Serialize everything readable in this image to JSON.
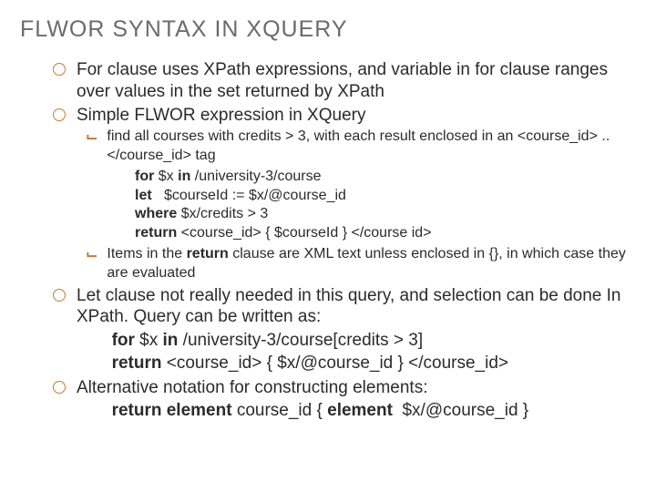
{
  "title": "FLWOR SYNTAX IN XQUERY",
  "b1": "For clause uses XPath expressions, and variable in for clause ranges over values in the set returned by XPath",
  "b2": "Simple FLWOR expression in XQuery",
  "s1": "find all courses with credits > 3, with each result enclosed in an <course_id> .. </course_id> tag",
  "c1_for": "for",
  "c1_for_rest": " $x ",
  "c1_in": "in",
  "c1_in_rest": " /university-3/course",
  "c1_let": "let",
  "c1_let_rest": "   $courseId := $x/@course_id",
  "c1_where": "where",
  "c1_where_rest": " $x/credits > 3",
  "c1_return": "return",
  "c1_return_rest": " <course_id> { $courseId } </course id>",
  "s2a": "Items in the ",
  "s2b": "return",
  "s2c": " clause are XML text unless enclosed in {}, in which case they are evaluated",
  "b3": "Let clause not really needed in this query, and selection can be done In XPath.  Query can be written as:",
  "c2_for": "for",
  "c2_for_rest": " $x ",
  "c2_in": "in",
  "c2_in_rest": " /university-3/course[credits > 3]",
  "c2_return": "return",
  "c2_return_rest": " <course_id> { $x/@course_id } </course_id>",
  "b4": "Alternative notation for constructing elements:",
  "c3_return": "return element",
  "c3_mid": " course_id { ",
  "c3_elem": "element",
  "c3_rest": "  $x/@course_id }"
}
